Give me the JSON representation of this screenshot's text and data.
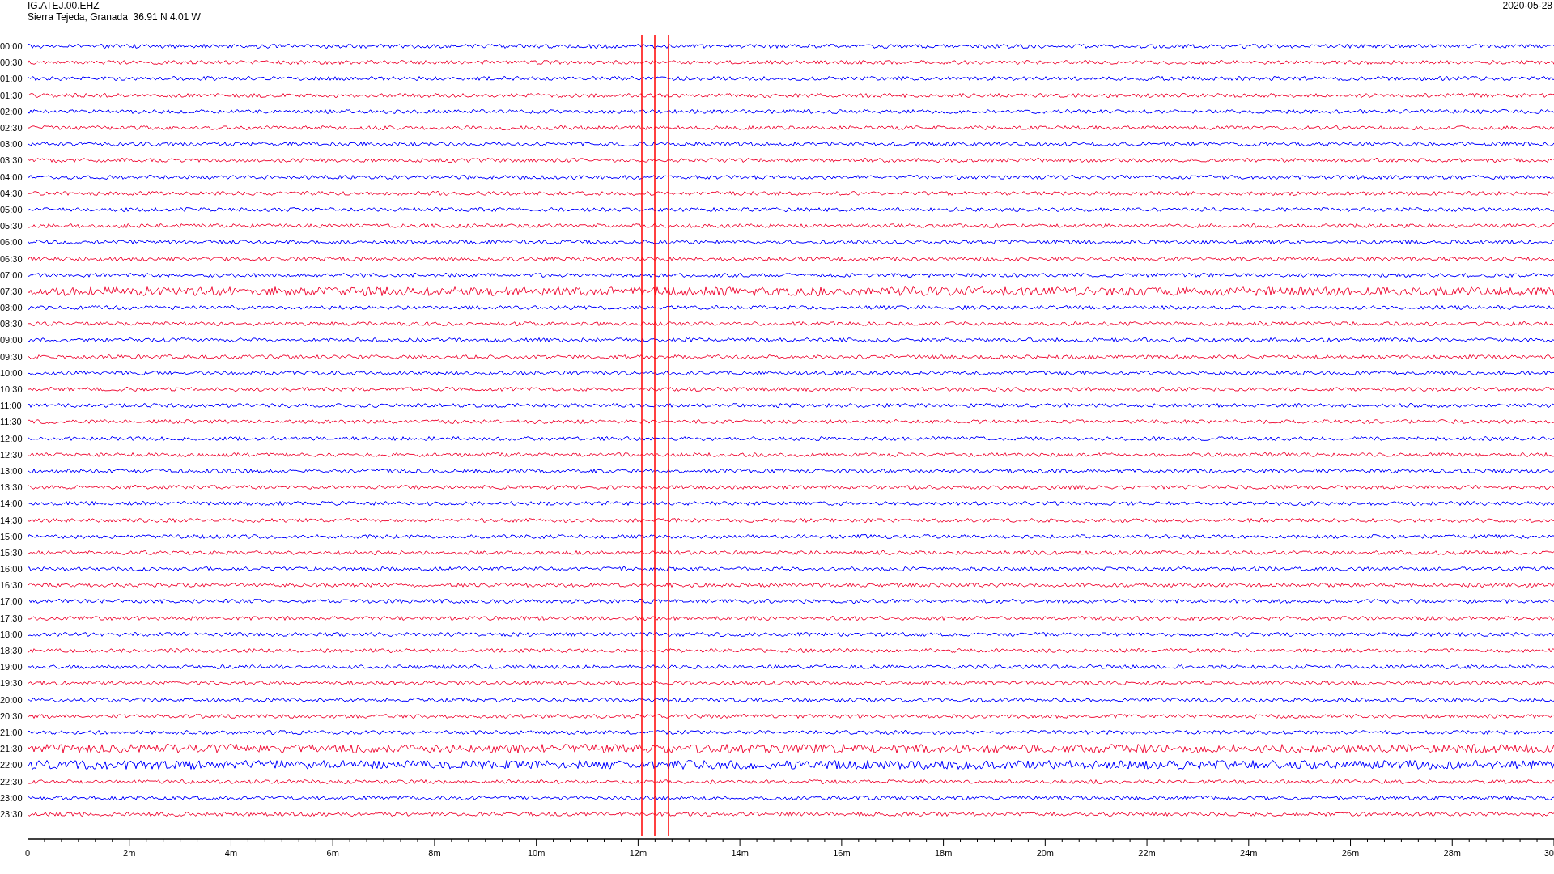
{
  "header": {
    "station": "IG.ATEJ.00.EHZ",
    "location": "Sierra Tejeda, Granada  36.91 N 4.01 W",
    "date": "2020-05-28"
  },
  "rows": [
    {
      "time": "00:00",
      "color": "#0000ff"
    },
    {
      "time": "00:30",
      "color": "#f0143c"
    },
    {
      "time": "01:00",
      "color": "#0000ff"
    },
    {
      "time": "01:30",
      "color": "#f0143c"
    },
    {
      "time": "02:00",
      "color": "#0000ff"
    },
    {
      "time": "02:30",
      "color": "#f0143c"
    },
    {
      "time": "03:00",
      "color": "#0000ff"
    },
    {
      "time": "03:30",
      "color": "#f0143c"
    },
    {
      "time": "04:00",
      "color": "#0000ff"
    },
    {
      "time": "04:30",
      "color": "#f0143c"
    },
    {
      "time": "05:00",
      "color": "#0000ff"
    },
    {
      "time": "05:30",
      "color": "#f0143c"
    },
    {
      "time": "06:00",
      "color": "#0000ff"
    },
    {
      "time": "06:30",
      "color": "#f0143c"
    },
    {
      "time": "07:00",
      "color": "#0000ff"
    },
    {
      "time": "07:30",
      "color": "#f0143c"
    },
    {
      "time": "08:00",
      "color": "#0000ff"
    },
    {
      "time": "08:30",
      "color": "#f0143c"
    },
    {
      "time": "09:00",
      "color": "#0000ff"
    },
    {
      "time": "09:30",
      "color": "#f0143c"
    },
    {
      "time": "10:00",
      "color": "#0000ff"
    },
    {
      "time": "10:30",
      "color": "#f0143c"
    },
    {
      "time": "11:00",
      "color": "#0000ff"
    },
    {
      "time": "11:30",
      "color": "#f0143c"
    },
    {
      "time": "12:00",
      "color": "#0000ff"
    },
    {
      "time": "12:30",
      "color": "#f0143c"
    },
    {
      "time": "13:00",
      "color": "#0000ff"
    },
    {
      "time": "13:30",
      "color": "#f0143c"
    },
    {
      "time": "14:00",
      "color": "#0000ff"
    },
    {
      "time": "14:30",
      "color": "#f0143c"
    },
    {
      "time": "15:00",
      "color": "#0000ff"
    },
    {
      "time": "15:30",
      "color": "#f0143c"
    },
    {
      "time": "16:00",
      "color": "#0000ff"
    },
    {
      "time": "16:30",
      "color": "#f0143c"
    },
    {
      "time": "17:00",
      "color": "#0000ff"
    },
    {
      "time": "17:30",
      "color": "#f0143c"
    },
    {
      "time": "18:00",
      "color": "#0000ff"
    },
    {
      "time": "18:30",
      "color": "#f0143c"
    },
    {
      "time": "19:00",
      "color": "#0000ff"
    },
    {
      "time": "19:30",
      "color": "#f0143c"
    },
    {
      "time": "20:00",
      "color": "#0000ff"
    },
    {
      "time": "20:30",
      "color": "#f0143c"
    },
    {
      "time": "21:00",
      "color": "#0000ff"
    },
    {
      "time": "21:30",
      "color": "#f0143c"
    },
    {
      "time": "22:00",
      "color": "#0000ff"
    },
    {
      "time": "22:30",
      "color": "#f0143c"
    },
    {
      "time": "23:00",
      "color": "#0000ff"
    },
    {
      "time": "23:30",
      "color": "#f0143c"
    }
  ],
  "x_axis": {
    "labels": [
      "0",
      "2m",
      "4m",
      "6m",
      "8m",
      "10m",
      "12m",
      "14m",
      "16m",
      "18m",
      "20m",
      "22m",
      "24m",
      "26m",
      "28m",
      "30"
    ]
  }
}
